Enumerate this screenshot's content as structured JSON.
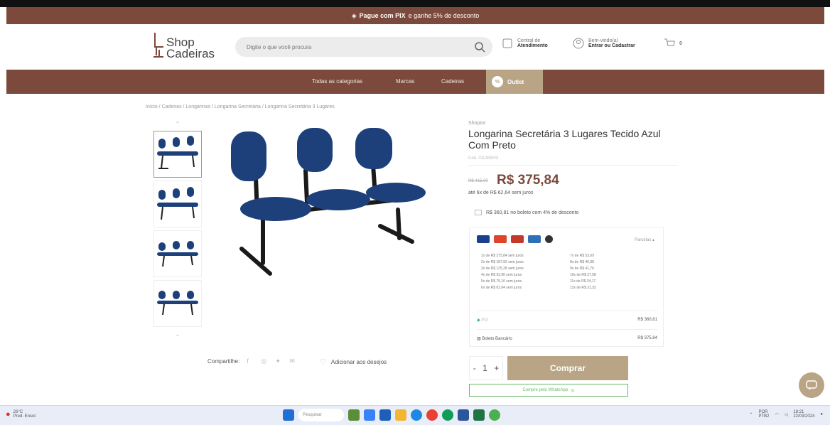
{
  "promo": {
    "bold": "Pague com PIX",
    "text": "e ganhe 5% de desconto"
  },
  "logo": {
    "line1": "Shop",
    "line2": "Cadeiras"
  },
  "search": {
    "placeholder": "Digite o que você procura"
  },
  "header": {
    "central_label": "Central de",
    "central_value": "Atendimento",
    "account_label": "Bem-vindo(a)",
    "account_value": "Entrar ou Cadastrar",
    "cart_count": "0"
  },
  "nav": {
    "items": [
      "Todas as categorias",
      "Marcas",
      "Cadeiras"
    ],
    "outlet": "Outlet"
  },
  "breadcrumb": "Início / Cadeiras / Longarinas / Longarina Secretária / Longarina Secretária 3 Lugares",
  "product": {
    "brand": "Shoptor",
    "title": "Longarina Secretária 3 Lugares Tecido Azul Com Preto",
    "sku": "Cód. 01LN0003",
    "old_price": "R$ 415,00",
    "price": "R$ 375,84",
    "installment": "até 6x de R$ 62,64 sem juros",
    "boleto": "R$ 360,81 no boleto com 4% de desconto",
    "share_label": "Compartilhe:",
    "wishlist_label": "Adicionar aos desejos"
  },
  "payment": {
    "toggle_label": "Parcelas",
    "installments": [
      "1x de R$ 375,84 sem juros",
      "7x de R$ 53,69",
      "2x de R$ 187,92 sem juros",
      "8x de R$ 46,98",
      "3x de R$ 125,28 sem juros",
      "9x de R$ 41,76",
      "4x de R$ 93,96 sem juros",
      "10x de R$ 37,58",
      "5x de R$ 75,16 sem juros",
      "11x de R$ 34,17",
      "6x de R$ 62,64 sem juros",
      "12x de R$ 31,32"
    ],
    "pix_label": "PIX",
    "pix_value": "R$ 360,81",
    "boleto_label": "Boleto Bancário",
    "boleto_value": "R$ 375,84"
  },
  "cart": {
    "qty": "1",
    "minus": "-",
    "plus": "+",
    "buy_label": "Comprar",
    "whatsapp_label": "Compre pelo WhatsApp"
  },
  "taskbar": {
    "weather_temp": "26°C",
    "weather_desc": "Pred. Ensol.",
    "search_label": "Pesquisar",
    "lang": "POR",
    "lang2": "PTB2",
    "time": "18:21",
    "date": "22/03/2024"
  },
  "colors": {
    "brand_brown": "#7b4a3c",
    "accent_gold": "#b9a585",
    "chair_blue": "#1d3f7a"
  }
}
